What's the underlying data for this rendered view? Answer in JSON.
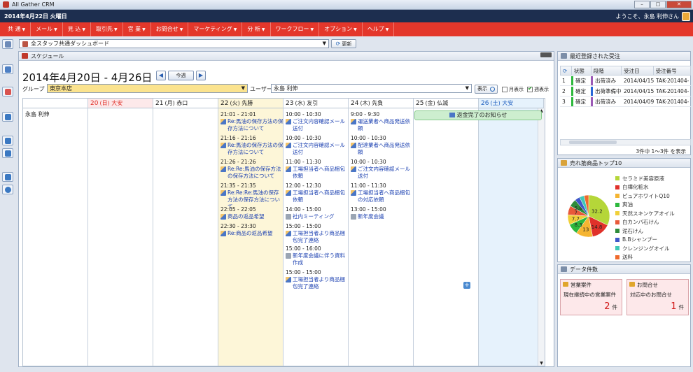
{
  "app": {
    "title": "All Gather CRM"
  },
  "infobar": {
    "date": "2014年4月22日 火曜日",
    "welcome": "ようこそ、永島 利伸さん"
  },
  "menu": [
    {
      "label": "共 通"
    },
    {
      "label": "メール"
    },
    {
      "label": "見 込"
    },
    {
      "label": "取引先"
    },
    {
      "label": "営 業"
    },
    {
      "label": "お問合せ"
    },
    {
      "label": "マーケティング"
    },
    {
      "label": "分 析"
    },
    {
      "label": "ワークフロー"
    },
    {
      "label": "オプション"
    },
    {
      "label": "ヘルプ"
    }
  ],
  "dashboard": {
    "selected": "全スタッフ共通ダッシュボード",
    "refresh_label": "更新"
  },
  "schedule": {
    "panel_title": "スケジュール",
    "range": "2014年4月20日 - 4月26日",
    "today_label": "今週",
    "group_label": "グループ",
    "group_value": "東京本店",
    "user_label": "ユーザー",
    "user_value": "永島 利伸",
    "show_label": "表示",
    "month_view_label": "月表示",
    "week_view_label": "週表示",
    "row_user": "永島 利伸",
    "days": [
      {
        "label": "20 (日) 大安",
        "num": "20",
        "rest": "(日) 大安",
        "color": "#e0312a",
        "bg": "#fde9ea"
      },
      {
        "label": "21 (月) 赤口",
        "num": "21",
        "rest": "(月) 赤口",
        "color": "#222",
        "bg": "#ffffff"
      },
      {
        "label": "22 (火) 先勝",
        "num": "22",
        "rest": "(火) 先勝",
        "color": "#222",
        "bg": "#fdf6d8"
      },
      {
        "label": "23 (水) 友引",
        "num": "23",
        "rest": "(水) 友引",
        "color": "#222",
        "bg": "#ffffff"
      },
      {
        "label": "24 (木) 先負",
        "num": "24",
        "rest": "(木) 先負",
        "color": "#222",
        "bg": "#ffffff"
      },
      {
        "label": "25 (金) 仏滅",
        "num": "25",
        "rest": "(金) 仏滅",
        "color": "#222",
        "bg": "#ffffff"
      },
      {
        "label": "26 (土) 大安",
        "num": "26",
        "rest": "(土) 大安",
        "color": "#2060c0",
        "bg": "#e6f2fc"
      }
    ],
    "events": {
      "tue": [
        {
          "time": "21:01 - 21:01",
          "subject": "Re:馬油の保存方法の保存方法について"
        },
        {
          "time": "21:16 - 21:16",
          "subject": "Re:馬油の保存方法の保存方法について"
        },
        {
          "time": "21:26 - 21:26",
          "subject": "Re:Re:馬油の保存方法の保存方法について"
        },
        {
          "time": "21:35 - 21:35",
          "subject": "Re:Re:Re:馬油の保存方法の保存方法について"
        },
        {
          "time": "22:05 - 22:05",
          "subject": "商品の返品希望"
        },
        {
          "time": "22:30 - 23:30",
          "subject": "Re:商品の返品希望"
        }
      ],
      "wed": [
        {
          "time": "10:00 - 10:30",
          "subject": "ご注文内容確認メール送付"
        },
        {
          "time": "10:00 - 10:30",
          "subject": "ご注文内容確認メール送付"
        },
        {
          "time": "11:00 - 11:30",
          "subject": "工場担当者へ商品梱包依頼"
        },
        {
          "time": "12:00 - 12:30",
          "subject": "工場担当者へ商品梱包依頼"
        },
        {
          "time": "14:00 - 15:00",
          "subject": "社内ミーティング"
        },
        {
          "time": "15:00 - 15:00",
          "subject": "工場担当者より商品梱包完了連絡"
        },
        {
          "time": "15:00 - 16:00",
          "subject": "新年度会議に伴う資料作成"
        },
        {
          "time": "15:00 - 15:00",
          "subject": "工場担当者より商品梱包完了連絡"
        }
      ],
      "thu": [
        {
          "time": "9:00 - 9:30",
          "subject": "運送業者へ商品発送依頼"
        },
        {
          "time": "10:00 - 10:30",
          "subject": "配達業者へ商品発送依頼"
        },
        {
          "time": "10:00 - 10:30",
          "subject": "ご注文内容確認メール送付"
        },
        {
          "time": "11:00 - 11:30",
          "subject": "工場担当者へ商品梱包の対応依頼"
        },
        {
          "time": "13:00 - 15:00",
          "subject": "新年度会議"
        }
      ],
      "fri_allday": "返金完了のお知らせ"
    }
  },
  "recent_orders": {
    "title": "最近登録された受注",
    "columns": [
      "状態",
      "段階",
      "受注日",
      "受注番号"
    ],
    "rows": [
      {
        "no": "1",
        "status": "確定",
        "status_color": "#2db83d",
        "stage": "出荷済み",
        "stage_color": "#9b59b6",
        "date": "2014/04/15",
        "number": "TAK-201404-"
      },
      {
        "no": "2",
        "status": "確定",
        "status_color": "#2db83d",
        "stage": "出荷準備中",
        "stage_color": "#2767d8",
        "date": "2014/04/15",
        "number": "TAK-201404-"
      },
      {
        "no": "3",
        "status": "確定",
        "status_color": "#2db83d",
        "stage": "出荷済み",
        "stage_color": "#9b59b6",
        "date": "2014/04/09",
        "number": "TAK-201404-"
      }
    ],
    "count_text": "3件中 1～3件 を表示"
  },
  "top10": {
    "title": "売れ筋商品トップ10",
    "items": [
      {
        "name": "セラミド美容原液",
        "color": "#b5d639"
      },
      {
        "name": "白樺化粧水",
        "color": "#e0312a"
      },
      {
        "name": "ピュアホワイトQ10",
        "color": "#f5b532"
      },
      {
        "name": "爽油",
        "color": "#2db83d"
      },
      {
        "name": "天然スキンケアオイル",
        "color": "#f0d03a"
      },
      {
        "name": "白カンバ石けん",
        "color": "#e85a3a"
      },
      {
        "name": "泥石けん",
        "color": "#2e8b3a"
      },
      {
        "name": "B.Bシャンプー",
        "color": "#3f57c9"
      },
      {
        "name": "クレンジングオイル",
        "color": "#3fc9b7"
      },
      {
        "name": "送料",
        "color": "#ef6a2c"
      }
    ],
    "pie_labels": [
      {
        "text": "32.2",
        "color": "#222"
      },
      {
        "text": "14.8",
        "color": "#222"
      },
      {
        "text": "13",
        "color": "#222"
      },
      {
        "text": "8.3",
        "color": "#222"
      },
      {
        "text": "7.7",
        "color": "#222"
      },
      {
        "text": "7",
        "color": "#222"
      },
      {
        "text": "5.8",
        "color": "#222"
      }
    ]
  },
  "data_count": {
    "title": "データ件数",
    "cards": [
      {
        "title": "営業案件",
        "desc": "現在継続中の営業案件",
        "value": "2",
        "unit": "件"
      },
      {
        "title": "お問合せ",
        "desc": "対応中のお問合せ",
        "value": "1",
        "unit": "件"
      }
    ]
  }
}
